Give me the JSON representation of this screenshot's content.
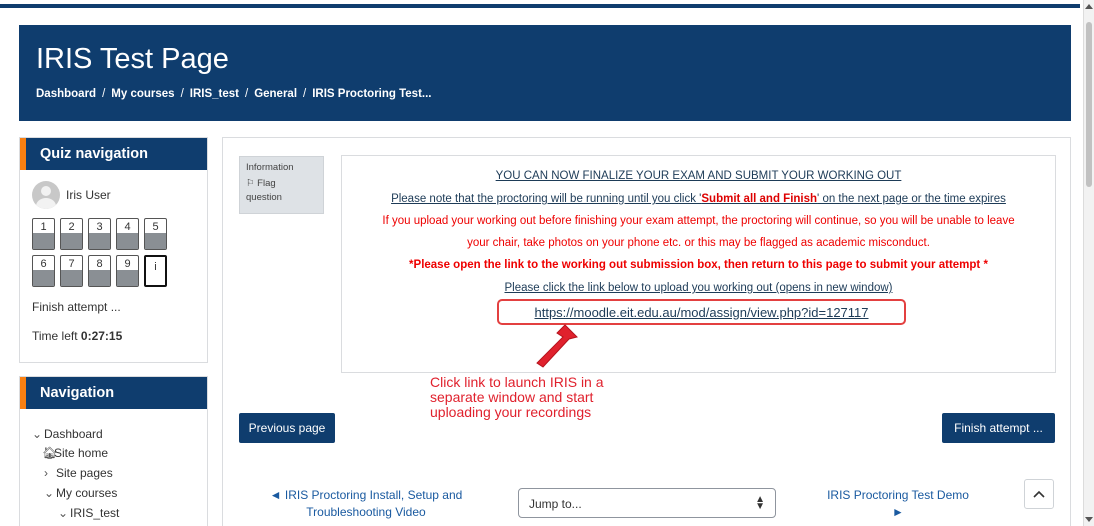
{
  "header": {
    "title": "IRIS Test Page",
    "breadcrumb": [
      "Dashboard",
      "My courses",
      "IRIS_test",
      "General",
      "IRIS Proctoring Test..."
    ],
    "separator": "/"
  },
  "quiz_nav": {
    "title": "Quiz navigation",
    "user": "Iris User",
    "row1": [
      "1",
      "2",
      "3",
      "4",
      "5"
    ],
    "row2": [
      "6",
      "7",
      "8",
      "9"
    ],
    "info_label": "i",
    "finish": "Finish attempt ...",
    "time_label": "Time left",
    "time_value": "0:27:15"
  },
  "navigation": {
    "title": "Navigation",
    "items": [
      "Dashboard",
      "Site home",
      "Site pages",
      "My courses",
      "IRIS_test"
    ]
  },
  "info_box": {
    "label": "Information",
    "flag": "Flag",
    "flag_line2": "question"
  },
  "content": {
    "heading": "YOU CAN NOW FINALIZE YOUR EXAM AND SUBMIT YOUR WORKING OUT",
    "note_pre": "Please note that the proctoring will be running until you click '",
    "note_bold": "Submit all and Finish",
    "note_post": "'  on the next page or the time expires",
    "warn_line1": "If you upload your working out before finishing your exam attempt, the proctoring will continue, so you will be unable to leave",
    "warn_line2": "your chair, take photos on your phone etc. or this may be flagged as academic misconduct.",
    "instruction": "*Please open the link to the working out submission box, then return to this page to submit your attempt *",
    "link_intro": "Please click the link below to upload you working out (opens in new window)",
    "url": " https://moodle.eit.edu.au/mod/assign/view.php?id=127117"
  },
  "annotation": {
    "line1": "Click link to launch IRIS in a",
    "line2": "separate window and start",
    "line3": "uploading your recordings",
    "color": "#e0212d"
  },
  "buttons": {
    "previous": "Previous page",
    "finish": "Finish attempt ..."
  },
  "footer_nav": {
    "prev_line1": "◄ IRIS Proctoring Install, Setup and",
    "prev_line2": "Troubleshooting Video",
    "jump": "Jump to...",
    "next_line1": "IRIS Proctoring Test Demo",
    "next_line2": "►"
  },
  "colors": {
    "brand": "#0f3d6e",
    "accent": "#f98012",
    "alert_red": "#e00000"
  }
}
